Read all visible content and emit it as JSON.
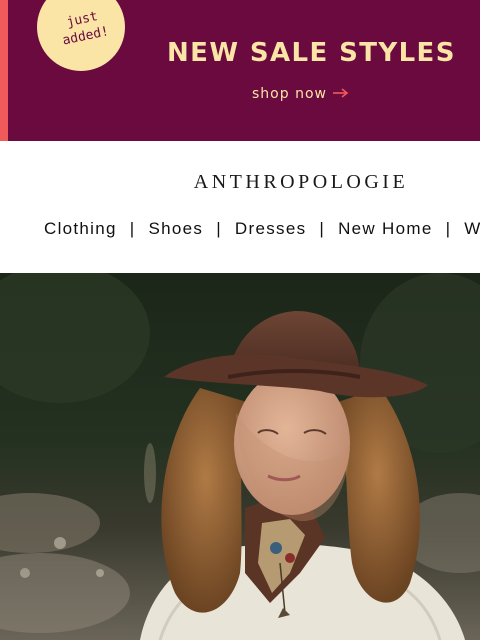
{
  "promo_banner": {
    "badge_line1": "just",
    "badge_line2": "added!",
    "title": "NEW SALE STYLES",
    "cta_label": "shop now",
    "icons": {
      "cta": "arrow-right-icon"
    },
    "colors": {
      "background": "#6a0a3f",
      "accent_stripe": "#f05a5a",
      "text": "#fbe5a6"
    }
  },
  "brand": {
    "logo_text": "ANTHROPOLOGIE"
  },
  "nav": {
    "items": [
      "Clothing",
      "Shoes",
      "Dresses",
      "New Home",
      "W"
    ],
    "separator": "|"
  },
  "hero": {
    "image": "woman-in-brown-fedora-photo"
  }
}
